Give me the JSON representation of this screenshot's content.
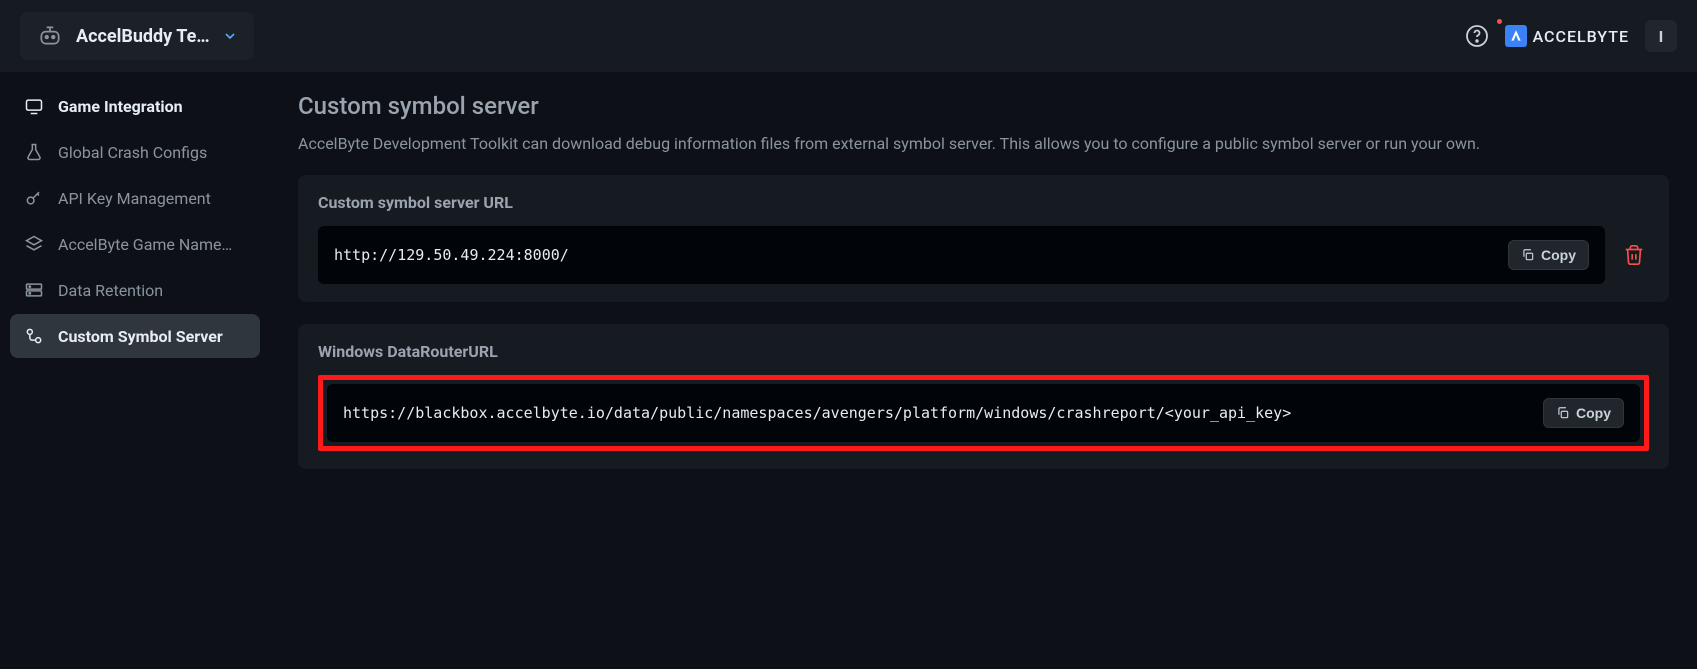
{
  "header": {
    "app_title": "AccelBuddy Te…",
    "brand_text": "ACCELBYTE",
    "user_initial": "I"
  },
  "sidebar": {
    "items": [
      {
        "label": "Game Integration"
      },
      {
        "label": "Global Crash Configs"
      },
      {
        "label": "API Key Management"
      },
      {
        "label": "AccelByte Game Name…"
      },
      {
        "label": "Data Retention"
      },
      {
        "label": "Custom Symbol Server"
      }
    ]
  },
  "main": {
    "title": "Custom symbol server",
    "description": "AccelByte Development Toolkit can download debug information files from external symbol server. This allows you to configure a public symbol server or run your own.",
    "section1": {
      "label": "Custom symbol server URL",
      "url": "http://129.50.49.224:8000/",
      "copy": "Copy"
    },
    "section2": {
      "label": "Windows DataRouterURL",
      "url": "https://blackbox.accelbyte.io/data/public/namespaces/avengers/platform/windows/crashreport/<your_api_key>",
      "copy": "Copy"
    }
  }
}
